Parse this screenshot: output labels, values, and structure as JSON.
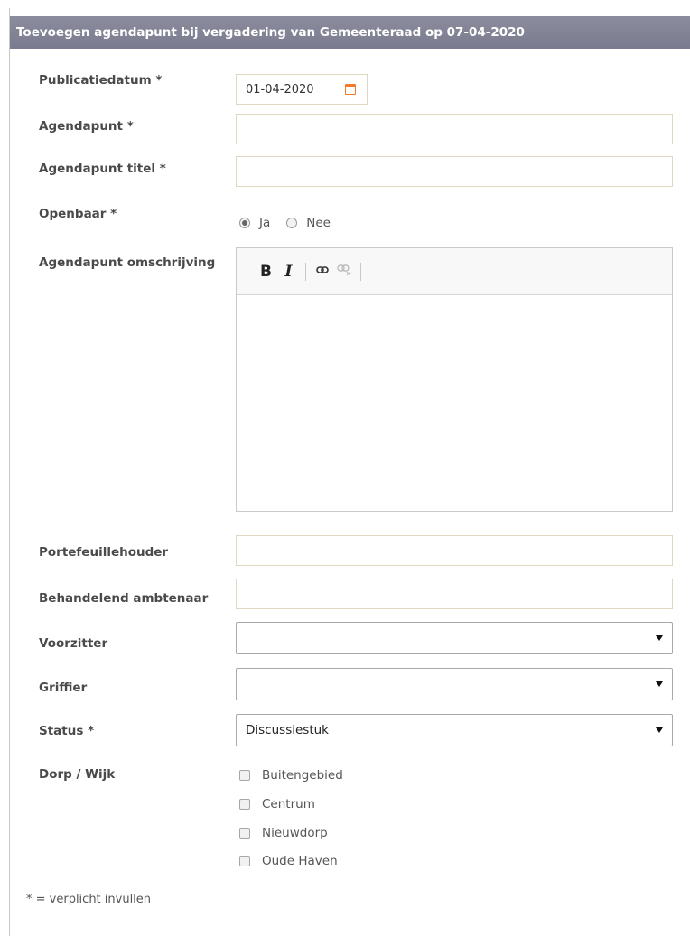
{
  "header": {
    "title": "Toevoegen agendapunt bij vergadering van Gemeenteraad op 07-04-2020"
  },
  "fields": {
    "publicatiedatum": {
      "label": "Publicatiedatum *",
      "value": "01-04-2020"
    },
    "agendapunt": {
      "label": "Agendapunt *",
      "value": ""
    },
    "agendapunt_titel": {
      "label": "Agendapunt titel *",
      "value": ""
    },
    "openbaar": {
      "label": "Openbaar *",
      "options": [
        "Ja",
        "Nee"
      ],
      "selected": "Ja"
    },
    "omschrijving": {
      "label": "Agendapunt omschrijving",
      "value": ""
    },
    "portefeuillehouder": {
      "label": "Portefeuillehouder",
      "value": ""
    },
    "behandelend_ambtenaar": {
      "label": "Behandelend ambtenaar",
      "value": ""
    },
    "voorzitter": {
      "label": "Voorzitter",
      "value": ""
    },
    "griffier": {
      "label": "Griffier",
      "value": ""
    },
    "status": {
      "label": "Status *",
      "value": "Discussiestuk"
    },
    "dorp_wijk": {
      "label": "Dorp / Wijk",
      "options": [
        "Buitengebied",
        "Centrum",
        "Nieuwdorp",
        "Oude Haven"
      ]
    }
  },
  "editor_toolbar": {
    "bold": "B",
    "italic": "I",
    "link_icon": "link-icon",
    "unlink_icon": "unlink-icon"
  },
  "icons": {
    "calendar": "calendar-icon"
  },
  "colors": {
    "header_bg": "#8b8c9d",
    "calendar_accent": "#f07a2a",
    "input_border": "#e0d6c2"
  },
  "footnote": "* = verplicht invullen"
}
